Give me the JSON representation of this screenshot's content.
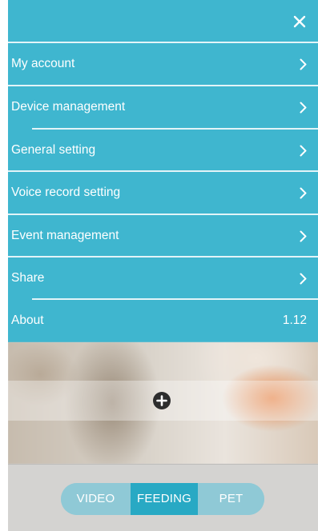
{
  "menu": {
    "items": [
      {
        "label": "My account",
        "trailing": "chevron"
      },
      {
        "label": "Device management",
        "trailing": "chevron"
      },
      {
        "label": "General setting",
        "trailing": "chevron"
      },
      {
        "label": "Voice record setting",
        "trailing": "chevron"
      },
      {
        "label": "Event management",
        "trailing": "chevron"
      },
      {
        "label": "Share",
        "trailing": "chevron"
      },
      {
        "label": "About",
        "value": "1.12"
      }
    ]
  },
  "tabs": [
    {
      "label": "VIDEO",
      "active": false
    },
    {
      "label": "FEEDING",
      "active": true
    },
    {
      "label": "PET",
      "active": false
    }
  ],
  "colors": {
    "menu_background": "#3fb6cf",
    "active_tab": "#28a9c4",
    "inactive_tab": "#8fc9d6"
  },
  "icons": {
    "close": "close-icon",
    "chevron": "chevron-right-icon",
    "add": "add-circle-icon"
  }
}
